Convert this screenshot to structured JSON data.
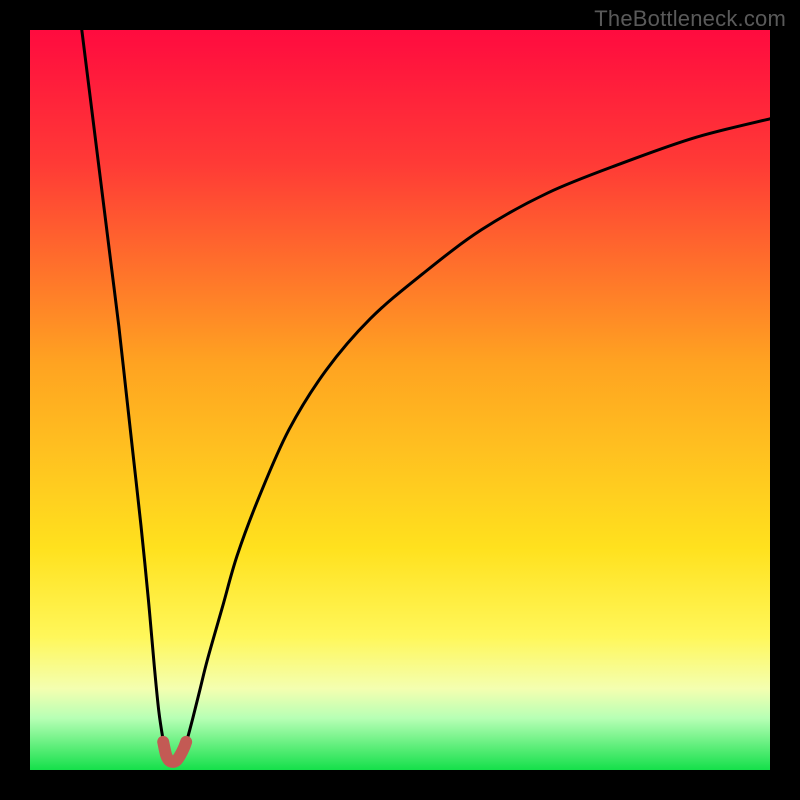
{
  "watermark": "TheBottleneck.com",
  "chart_data": {
    "type": "line",
    "title": "",
    "xlabel": "",
    "ylabel": "",
    "xlim": [
      0,
      100
    ],
    "ylim": [
      0,
      100
    ],
    "gradient_stops": [
      {
        "offset": 0,
        "color": "#ff0b3f"
      },
      {
        "offset": 18,
        "color": "#ff3a36"
      },
      {
        "offset": 45,
        "color": "#ffa321"
      },
      {
        "offset": 70,
        "color": "#ffe11e"
      },
      {
        "offset": 82,
        "color": "#fff75a"
      },
      {
        "offset": 89,
        "color": "#f4ffb0"
      },
      {
        "offset": 93,
        "color": "#b7ffb5"
      },
      {
        "offset": 100,
        "color": "#14e04a"
      }
    ],
    "series": [
      {
        "name": "left-branch",
        "x": [
          7,
          8,
          9,
          10,
          11,
          12,
          13,
          14,
          15,
          16,
          16.8,
          17.4,
          18.0,
          18.4
        ],
        "y": [
          100,
          92,
          84,
          76,
          68,
          60,
          51,
          42,
          33,
          23,
          14,
          8,
          4,
          2
        ]
      },
      {
        "name": "right-branch",
        "x": [
          20.6,
          21.2,
          22,
          23,
          24,
          26,
          28,
          31,
          35,
          40,
          46,
          53,
          61,
          70,
          80,
          90,
          100
        ],
        "y": [
          2,
          4,
          7,
          11,
          15,
          22,
          29,
          37,
          46,
          54,
          61,
          67,
          73,
          78,
          82,
          85.5,
          88
        ]
      },
      {
        "name": "trough-marker",
        "x": [
          18.0,
          18.4,
          18.8,
          19.3,
          19.8,
          20.3,
          20.8,
          21.1
        ],
        "y": [
          3.8,
          2.0,
          1.3,
          1.1,
          1.3,
          2.0,
          3.0,
          3.8
        ]
      }
    ],
    "trough_color": "#c35a54",
    "curve_color": "#000000"
  }
}
